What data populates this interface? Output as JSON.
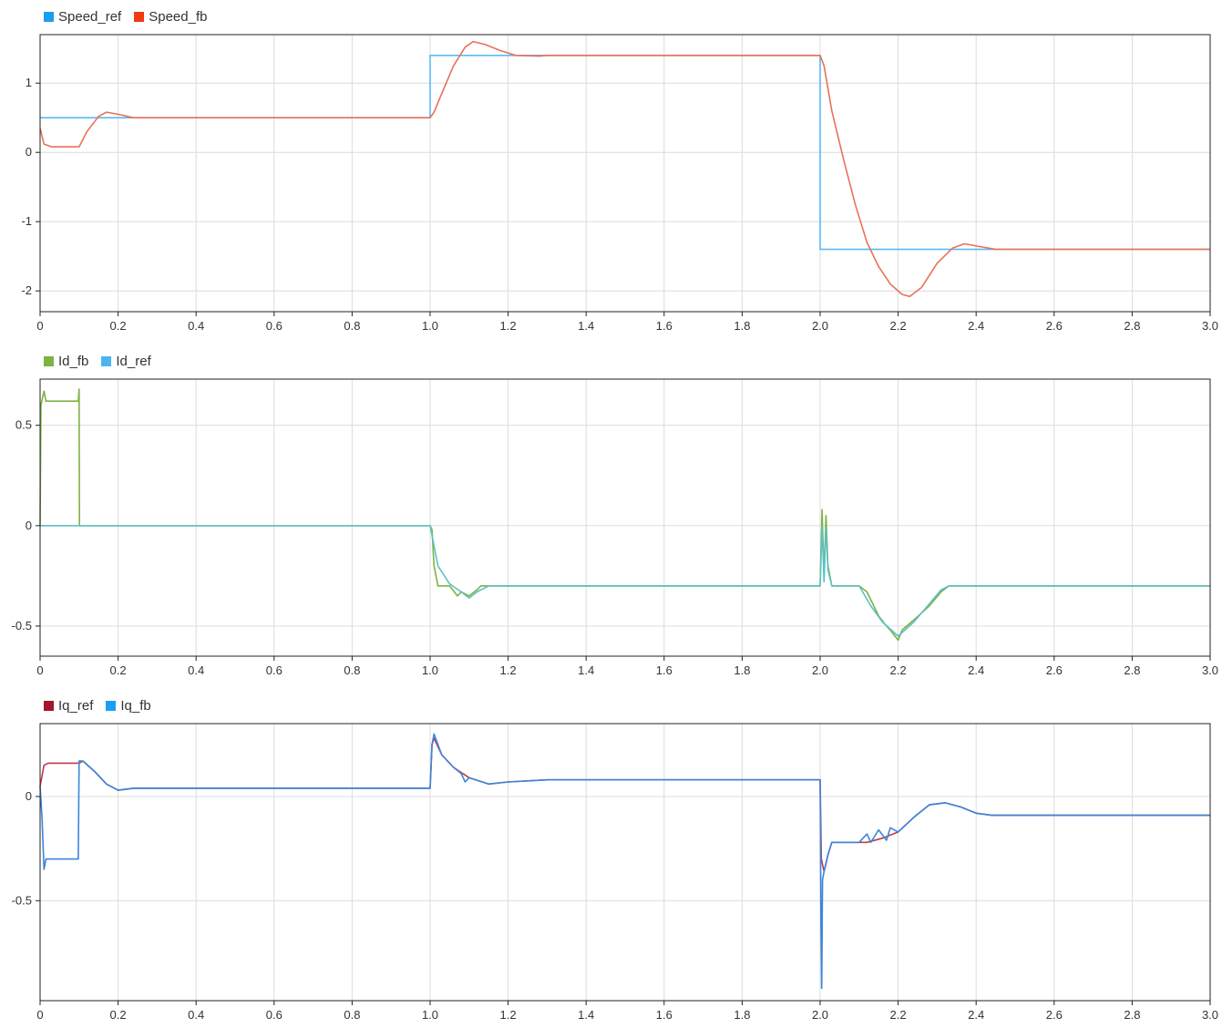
{
  "chart_data": [
    {
      "type": "line",
      "title": "",
      "legend": {
        "placement": "top-left"
      },
      "xlim": [
        0,
        3.0
      ],
      "ylim": [
        -2.3,
        1.7
      ],
      "grid": true,
      "x_ticks": [
        0,
        0.2,
        0.4,
        0.6,
        0.8,
        1.0,
        1.2,
        1.4,
        1.6,
        1.8,
        2.0,
        2.2,
        2.4,
        2.6,
        2.8,
        3.0
      ],
      "x_tick_labels": [
        "0",
        "0.2",
        "0.4",
        "0.6",
        "0.8",
        "1.0",
        "1.2",
        "1.4",
        "1.6",
        "1.8",
        "2.0",
        "2.2",
        "2.4",
        "2.6",
        "2.8",
        "3.0"
      ],
      "y_ticks": [
        1,
        0,
        -1,
        -2
      ],
      "y_tick_labels": [
        "1",
        "0",
        "-1",
        "-2"
      ],
      "series": [
        {
          "name": "Speed_ref",
          "color": "#5cb9f3",
          "legend_color": "#1a9ff0",
          "x": [
            0,
            1.0,
            1.0,
            2.0,
            2.0,
            3.0
          ],
          "y": [
            0.5,
            0.5,
            1.4,
            1.4,
            -1.4,
            -1.4
          ]
        },
        {
          "name": "Speed_fb",
          "color": "#e8725a",
          "legend_color": "#f23a14",
          "x": [
            0,
            0.01,
            0.03,
            0.1,
            0.12,
            0.15,
            0.17,
            0.2,
            0.24,
            0.3,
            1.0,
            1.01,
            1.03,
            1.06,
            1.09,
            1.11,
            1.14,
            1.18,
            1.22,
            1.28,
            1.3,
            2.0,
            2.01,
            2.03,
            2.06,
            2.09,
            2.12,
            2.15,
            2.18,
            2.21,
            2.23,
            2.26,
            2.3,
            2.34,
            2.37,
            2.41,
            2.45,
            2.5,
            3.0
          ],
          "y": [
            0.35,
            0.12,
            0.08,
            0.08,
            0.3,
            0.52,
            0.58,
            0.55,
            0.5,
            0.5,
            0.5,
            0.58,
            0.85,
            1.25,
            1.52,
            1.6,
            1.56,
            1.47,
            1.4,
            1.39,
            1.4,
            1.4,
            1.25,
            0.6,
            -0.1,
            -0.75,
            -1.3,
            -1.65,
            -1.9,
            -2.05,
            -2.08,
            -1.95,
            -1.6,
            -1.38,
            -1.32,
            -1.36,
            -1.4,
            -1.4,
            -1.4
          ]
        }
      ]
    },
    {
      "type": "line",
      "title": "",
      "legend": {
        "placement": "top-left"
      },
      "xlim": [
        0,
        3.0
      ],
      "ylim": [
        -0.65,
        0.73
      ],
      "grid": true,
      "x_ticks": [
        0,
        0.2,
        0.4,
        0.6,
        0.8,
        1.0,
        1.2,
        1.4,
        1.6,
        1.8,
        2.0,
        2.2,
        2.4,
        2.6,
        2.8,
        3.0
      ],
      "x_tick_labels": [
        "0",
        "0.2",
        "0.4",
        "0.6",
        "0.8",
        "1.0",
        "1.2",
        "1.4",
        "1.6",
        "1.8",
        "2.0",
        "2.2",
        "2.4",
        "2.6",
        "2.8",
        "3.0"
      ],
      "y_ticks": [
        0.5,
        0,
        -0.5
      ],
      "y_tick_labels": [
        "0.5",
        "0",
        "-0.5"
      ],
      "series": [
        {
          "name": "Id_fb",
          "color": "#7cb342",
          "legend_color": "#7cb342",
          "x": [
            0,
            0.002,
            0.01,
            0.015,
            0.02,
            0.03,
            0.05,
            0.098,
            0.1,
            0.101,
            0.11,
            1.0,
            1.005,
            1.01,
            1.02,
            1.05,
            1.07,
            1.08,
            1.1,
            1.12,
            1.13,
            1.15,
            2.0,
            2.005,
            2.01,
            2.015,
            2.02,
            2.03,
            2.05,
            2.1,
            2.12,
            2.15,
            2.17,
            2.18,
            2.2,
            2.21,
            2.24,
            2.28,
            2.31,
            2.33,
            3.0
          ],
          "y": [
            0,
            0.6,
            0.67,
            0.62,
            0.62,
            0.62,
            0.62,
            0.62,
            0.68,
            0,
            0,
            0,
            -0.02,
            -0.2,
            -0.3,
            -0.3,
            -0.35,
            -0.33,
            -0.35,
            -0.32,
            -0.3,
            -0.3,
            -0.3,
            0.08,
            -0.25,
            0.05,
            -0.2,
            -0.3,
            -0.3,
            -0.3,
            -0.33,
            -0.45,
            -0.5,
            -0.52,
            -0.57,
            -0.52,
            -0.47,
            -0.4,
            -0.33,
            -0.3,
            -0.3
          ]
        },
        {
          "name": "Id_ref",
          "color": "#5fc0c5",
          "legend_color": "#4cb4f0",
          "x": [
            0,
            0.1,
            1.0,
            1.02,
            1.05,
            1.08,
            1.1,
            1.12,
            1.15,
            2.0,
            2.005,
            2.01,
            2.015,
            2.02,
            2.03,
            2.05,
            2.1,
            2.13,
            2.16,
            2.2,
            2.24,
            2.28,
            2.31,
            2.33,
            3.0
          ],
          "y": [
            0,
            0,
            0,
            -0.2,
            -0.29,
            -0.33,
            -0.36,
            -0.33,
            -0.3,
            -0.3,
            0.0,
            -0.28,
            -0.01,
            -0.22,
            -0.3,
            -0.3,
            -0.3,
            -0.4,
            -0.48,
            -0.55,
            -0.48,
            -0.39,
            -0.32,
            -0.3,
            -0.3
          ]
        }
      ]
    },
    {
      "type": "line",
      "title": "",
      "legend": {
        "placement": "top-left"
      },
      "xlim": [
        0,
        3.0
      ],
      "ylim": [
        -0.98,
        0.35
      ],
      "grid": true,
      "x_ticks": [
        0,
        0.2,
        0.4,
        0.6,
        0.8,
        1.0,
        1.2,
        1.4,
        1.6,
        1.8,
        2.0,
        2.2,
        2.4,
        2.6,
        2.8,
        3.0
      ],
      "x_tick_labels": [
        "0",
        "0.2",
        "0.4",
        "0.6",
        "0.8",
        "1.0",
        "1.2",
        "1.4",
        "1.6",
        "1.8",
        "2.0",
        "2.2",
        "2.4",
        "2.6",
        "2.8",
        "3.0"
      ],
      "y_ticks": [
        0,
        -0.5
      ],
      "y_tick_labels": [
        "0",
        "-0.5"
      ],
      "series": [
        {
          "name": "Iq_ref",
          "color": "#c0394b",
          "legend_color": "#a3162b",
          "x": [
            0,
            0.01,
            0.02,
            0.1,
            0.11,
            0.14,
            0.17,
            0.2,
            0.24,
            0.3,
            1.0,
            1.005,
            1.01,
            1.03,
            1.06,
            1.1,
            1.15,
            1.2,
            1.3,
            2.0,
            2.003,
            2.01,
            2.02,
            2.03,
            2.05,
            2.1,
            2.12,
            2.16,
            2.2,
            2.24,
            2.28,
            2.32,
            2.36,
            2.4,
            2.44,
            2.5,
            3.0
          ],
          "y": [
            0.05,
            0.15,
            0.16,
            0.16,
            0.17,
            0.12,
            0.06,
            0.03,
            0.04,
            0.04,
            0.04,
            0.25,
            0.28,
            0.2,
            0.14,
            0.09,
            0.06,
            0.07,
            0.08,
            0.08,
            -0.3,
            -0.36,
            -0.28,
            -0.22,
            -0.22,
            -0.22,
            -0.22,
            -0.2,
            -0.17,
            -0.1,
            -0.04,
            -0.03,
            -0.05,
            -0.08,
            -0.09,
            -0.09,
            -0.09
          ]
        },
        {
          "name": "Iq_fb",
          "color": "#3a86d9",
          "legend_color": "#1a9ff0",
          "x": [
            0,
            0.005,
            0.01,
            0.015,
            0.02,
            0.05,
            0.098,
            0.1,
            0.11,
            0.14,
            0.17,
            0.2,
            0.24,
            0.3,
            1.0,
            1.005,
            1.01,
            1.03,
            1.06,
            1.08,
            1.09,
            1.1,
            1.15,
            1.2,
            1.3,
            2.0,
            2.002,
            2.004,
            2.006,
            2.01,
            2.02,
            2.03,
            2.05,
            2.1,
            2.12,
            2.13,
            2.15,
            2.17,
            2.18,
            2.2,
            2.24,
            2.28,
            2.32,
            2.36,
            2.4,
            2.44,
            2.5,
            3.0
          ],
          "y": [
            0.05,
            -0.1,
            -0.35,
            -0.3,
            -0.3,
            -0.3,
            -0.3,
            0.17,
            0.17,
            0.12,
            0.06,
            0.03,
            0.04,
            0.04,
            0.04,
            0.25,
            0.3,
            0.2,
            0.14,
            0.11,
            0.07,
            0.09,
            0.06,
            0.07,
            0.08,
            0.08,
            -0.6,
            -0.92,
            -0.4,
            -0.36,
            -0.28,
            -0.22,
            -0.22,
            -0.22,
            -0.18,
            -0.22,
            -0.16,
            -0.21,
            -0.15,
            -0.17,
            -0.1,
            -0.04,
            -0.03,
            -0.05,
            -0.08,
            -0.09,
            -0.09,
            -0.09
          ]
        }
      ]
    }
  ]
}
